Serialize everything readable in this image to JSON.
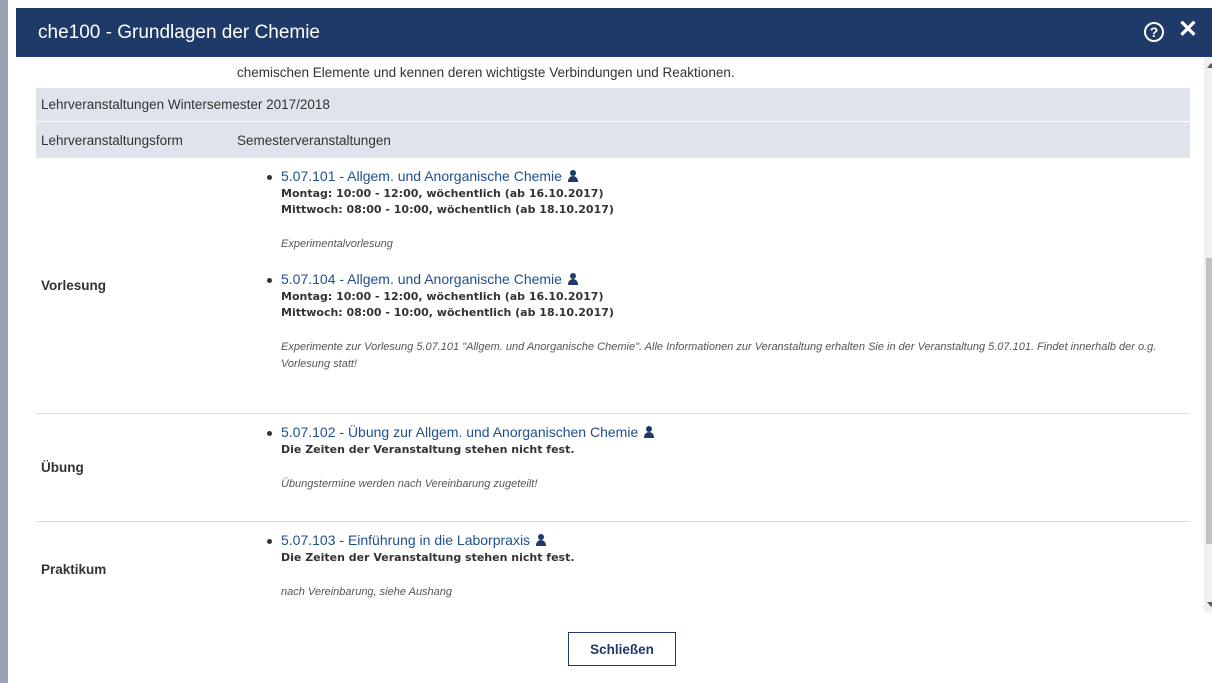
{
  "window": {
    "title": "che100 - Grundlagen der Chemie",
    "help_icon": "?",
    "close_icon": "✕"
  },
  "description_tail": "chemischen Elemente und kennen deren wichtigste Verbindungen und Reaktionen.",
  "semester": {
    "title": "Lehrveranstaltungen Wintersemester 2017/2018",
    "col_form": "Lehrveranstaltungsform",
    "col_events": "Semesterveranstaltungen"
  },
  "rows": {
    "vorlesung": {
      "label": "Vorlesung",
      "courses": [
        {
          "link": "5.07.101 - Allgem. und Anorganische Chemie",
          "time1": "Montag: 10:00 - 12:00, wöchentlich (ab 16.10.2017)",
          "time2": "Mittwoch: 08:00 - 10:00, wöchentlich (ab 18.10.2017)",
          "note": "Experimentalvorlesung"
        },
        {
          "link": "5.07.104 - Allgem. und Anorganische Chemie",
          "time1": "Montag: 10:00 - 12:00, wöchentlich (ab 16.10.2017)",
          "time2": "Mittwoch: 08:00 - 10:00, wöchentlich (ab 18.10.2017)",
          "note": "Experimente zur Vorlesung 5.07.101 \"Allgem. und Anorganische Chemie\". Alle Informationen zur Veranstaltung erhalten Sie in der Veranstaltung 5.07.101. Findet innerhalb der o.g. Vorlesung statt!"
        }
      ]
    },
    "uebung": {
      "label": "Übung",
      "link": "5.07.102 - Übung zur Allgem. und Anorganischen Chemie",
      "time": "Die Zeiten der Veranstaltung stehen nicht fest.",
      "note": "Übungstermine werden nach Vereinbarung zugeteilt!"
    },
    "praktikum": {
      "label": "Praktikum",
      "link": "5.07.103 - Einführung in die Laborpraxis",
      "time": "Die Zeiten der Veranstaltung stehen nicht fest.",
      "note": "nach Vereinbarung, siehe Aushang"
    }
  },
  "footer": {
    "close_label": "Schließen"
  },
  "colors": {
    "titlebar": "#1f3a68",
    "header_bg": "#dfe3ec",
    "link": "#1f4f8f"
  }
}
